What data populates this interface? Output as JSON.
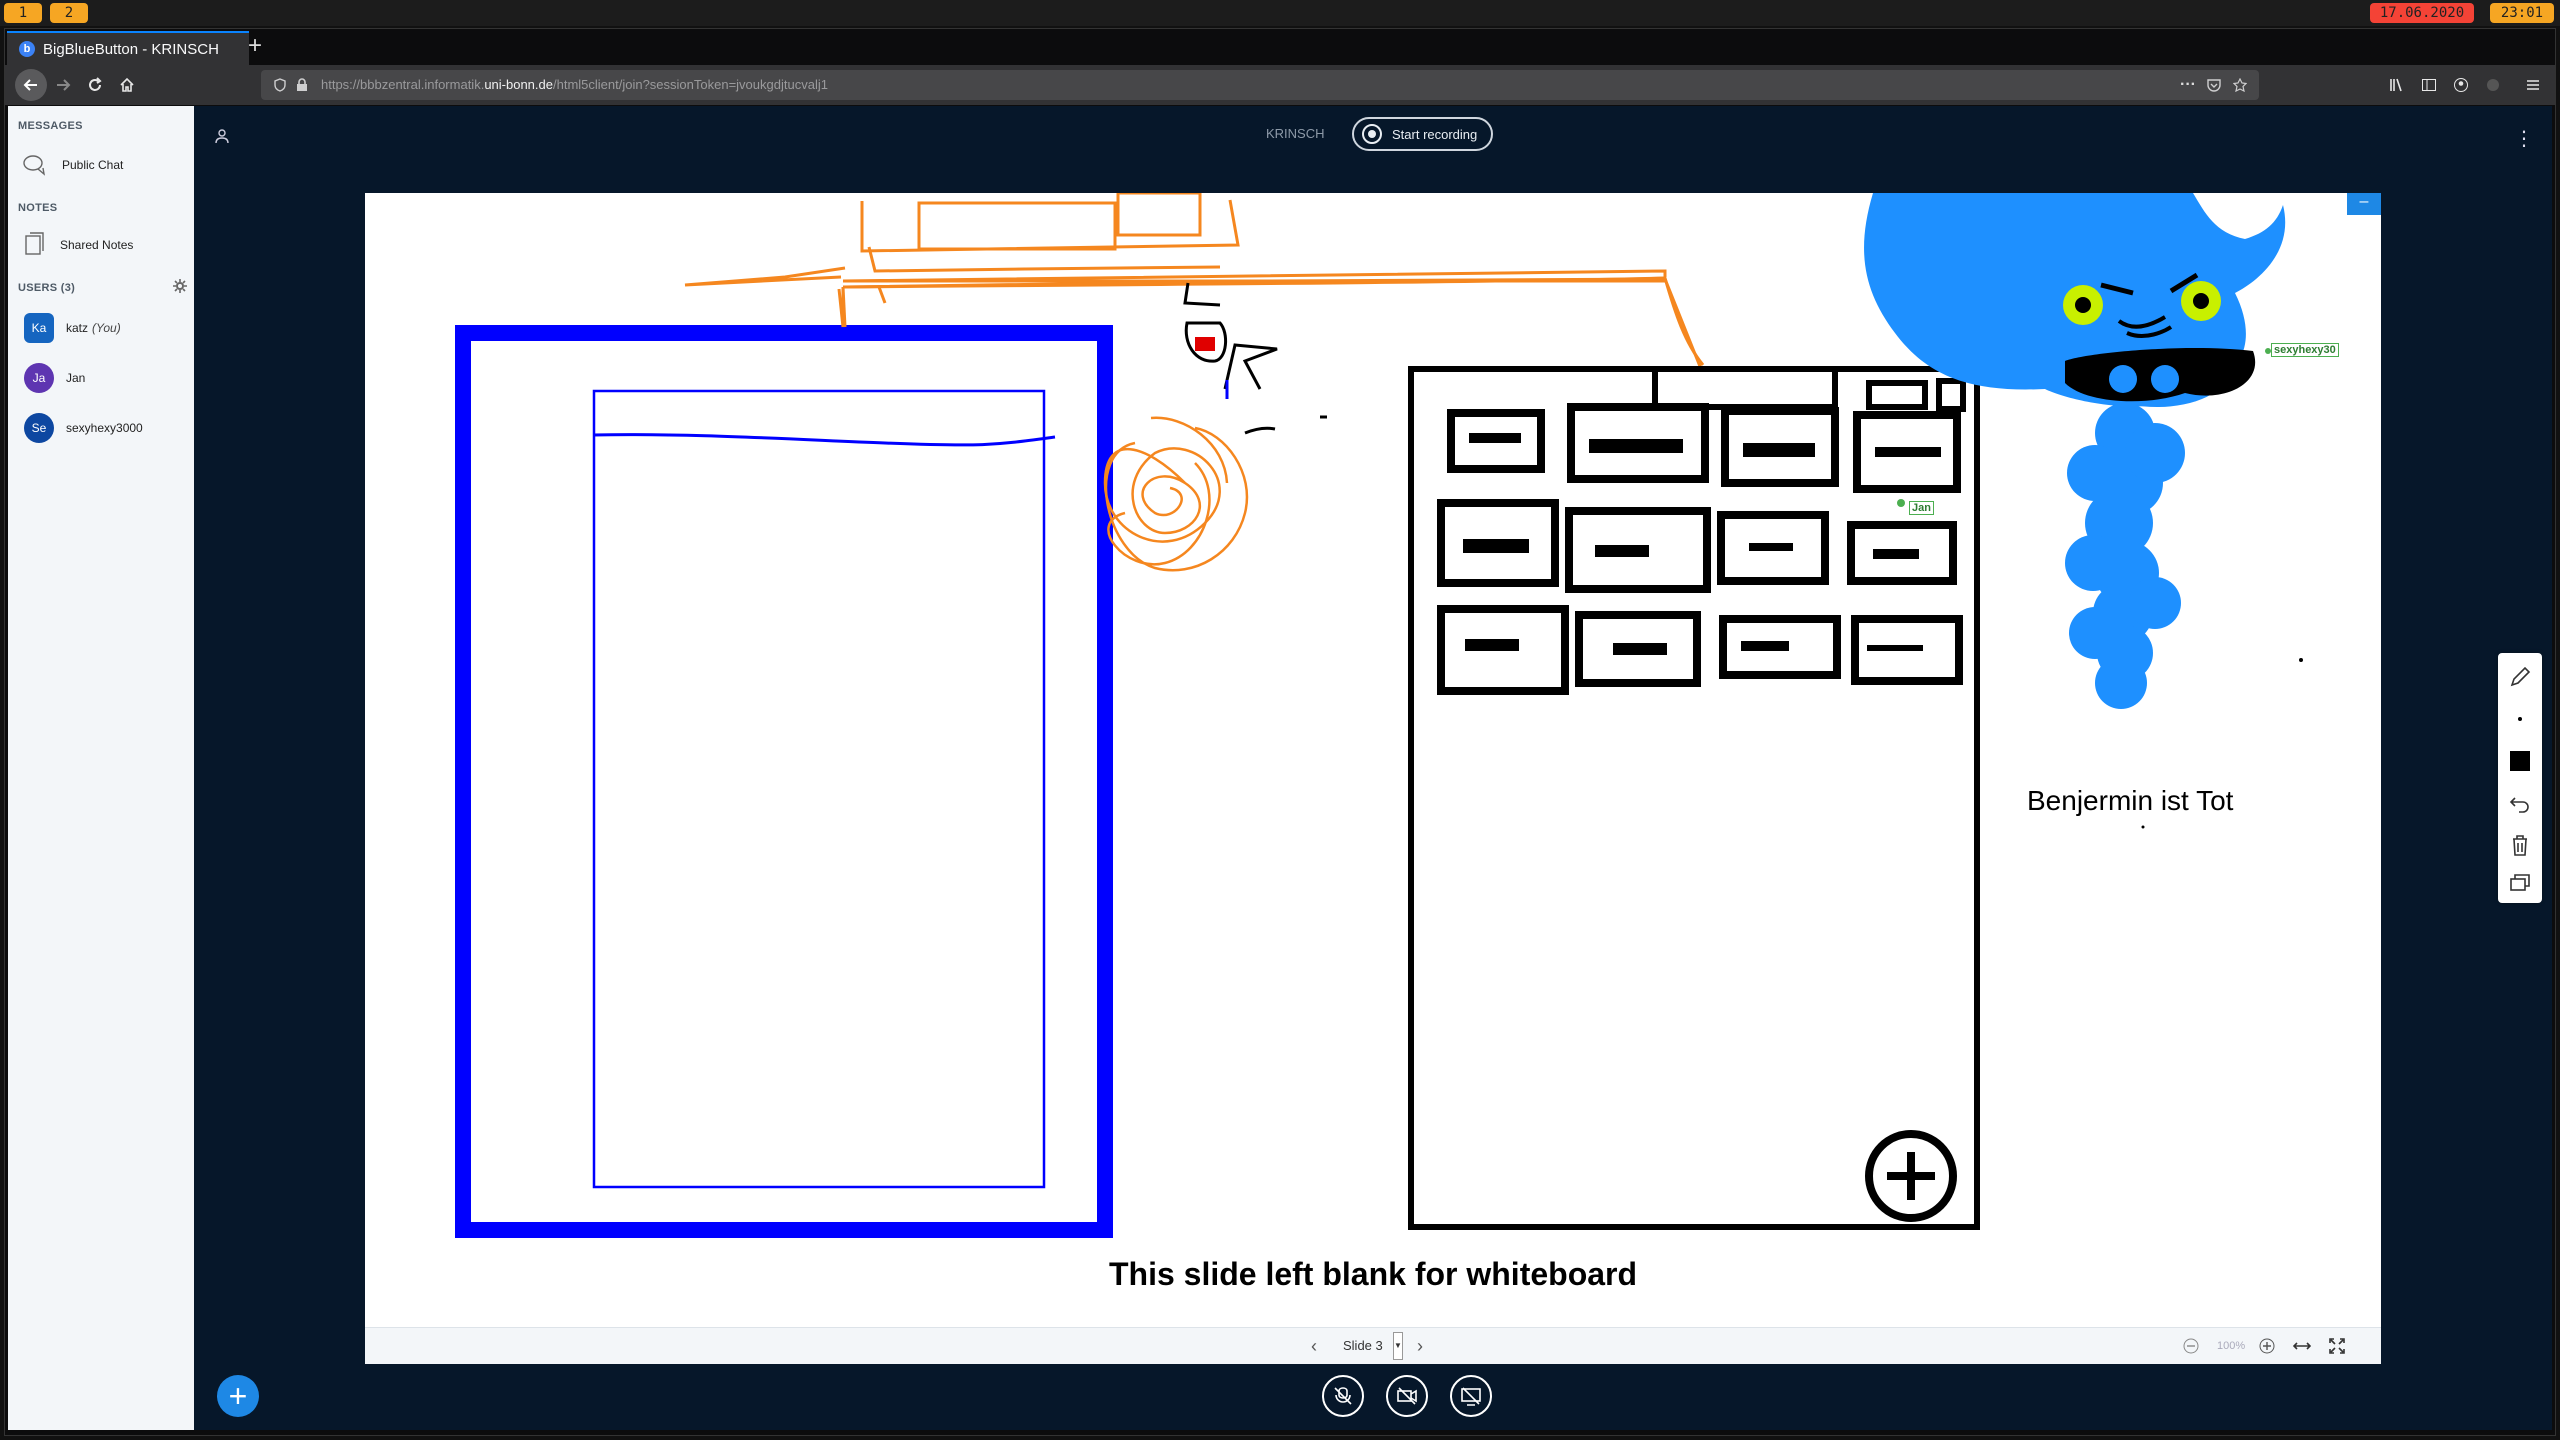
{
  "os": {
    "workspaces": [
      "1",
      "2"
    ],
    "date": "17.06.2020",
    "time": "23:01",
    "colors": {
      "workspace": "#f6a623",
      "date_bg": "#f44336",
      "time_bg": "#f6a623"
    }
  },
  "browser": {
    "tab_title": "BigBlueButton - KRINSCH",
    "url_prefix": "https://bbbzentral.informatik.",
    "url_domain": "uni-bonn.de",
    "url_suffix": "/html5client/join?sessionToken=jvoukgdjtucvalj1",
    "url_dots": "···"
  },
  "sidebar": {
    "messages_header": "MESSAGES",
    "public_chat": "Public Chat",
    "notes_header": "NOTES",
    "shared_notes": "Shared Notes",
    "users_header": "USERS (3)",
    "users": [
      {
        "initials": "Ka",
        "name": "katz",
        "suffix": "(You)",
        "color": "#1565c0"
      },
      {
        "initials": "Ja",
        "name": "Jan",
        "suffix": "",
        "color": "#5e35b1"
      },
      {
        "initials": "Se",
        "name": "sexyhexy3000",
        "suffix": "",
        "color": "#0d47a1"
      }
    ]
  },
  "header": {
    "meeting_title": "KRINSCH",
    "record_label": "Start recording"
  },
  "slide": {
    "caption": "This slide left blank for whiteboard",
    "annotation_text": "Benjermin ist Tot",
    "cursor_jan": "Jan",
    "cursor_sexyhexy": "sexyhexy30",
    "slide_label": "Slide 3",
    "zoom_level": "100%",
    "minimize_label": "–"
  }
}
